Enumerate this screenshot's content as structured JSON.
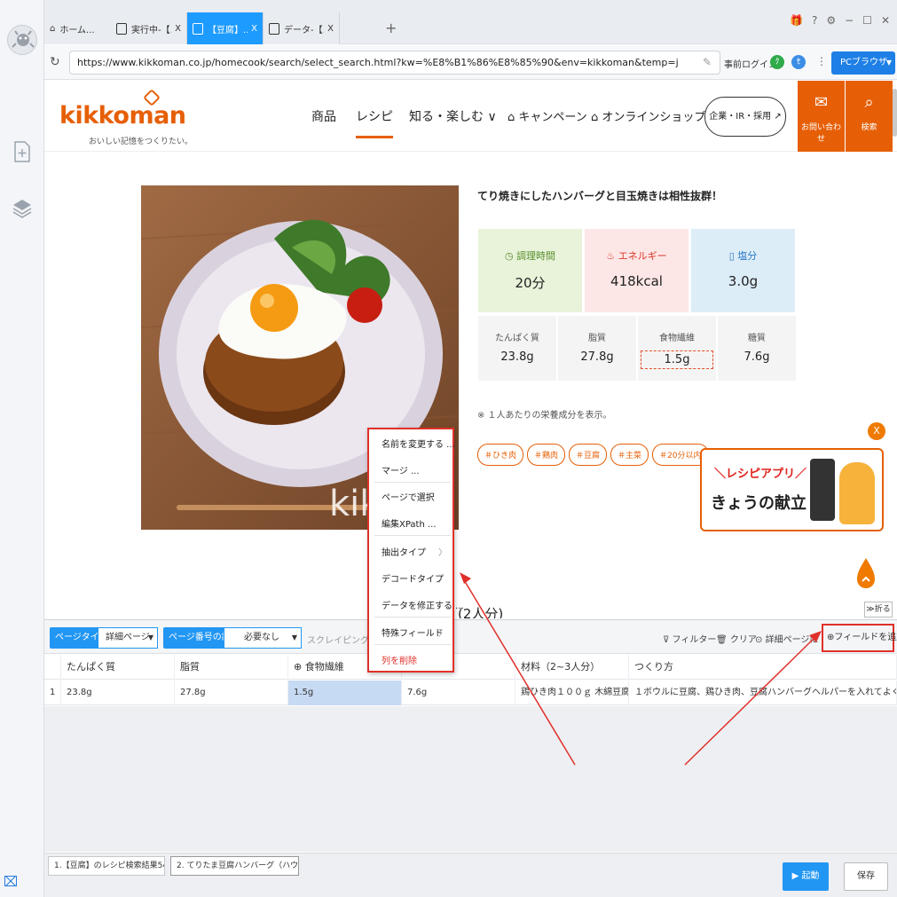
{
  "tabs": [
    {
      "label": "ホーム...",
      "close": ""
    },
    {
      "label": "実行中-【...",
      "close": "X"
    },
    {
      "label": "【豆腐】...",
      "close": "X"
    },
    {
      "label": "データ-【...",
      "close": "X"
    }
  ],
  "tab_plus": "+",
  "window_controls": [
    "🎁",
    "?",
    "⚙",
    "−",
    "☐",
    "✕"
  ],
  "address": {
    "url": "https://www.kikkoman.co.jp/homecook/search/select_search.html?kw=%E8%B1%86%E8%85%90&env=kikkoman&temp=j",
    "prelogin": "事前ログイン",
    "pc_browser": "PCブラウザ"
  },
  "site": {
    "logo": "kikkoman",
    "logo_sub": "おいしい記憶をつくりたい。",
    "nav": [
      "商品",
      "レシピ",
      "知る・楽しむ ∨",
      "⌂ キャンペーン",
      "⌂ オンラインショップ"
    ],
    "corp_button": "企業・IR・採用 ↗",
    "contact": "お問い合わせ",
    "search": "検索",
    "photo_watermark": "kikk"
  },
  "recipe": {
    "tagline": "てり焼きにしたハンバーグと目玉焼きは相性抜群！",
    "nutrition_top": [
      {
        "label": "調理時間",
        "value": "20分",
        "icon": "clock-icon",
        "bg": "#e8f3da",
        "color": "#5a8f2e"
      },
      {
        "label": "エネルギー",
        "value": "418kcal",
        "icon": "flame-icon",
        "bg": "#fde7e6",
        "color": "#d9362b"
      },
      {
        "label": "塩分",
        "value": "3.0g",
        "icon": "salt-icon",
        "bg": "#dcedf8",
        "color": "#2a78c4"
      }
    ],
    "nutrition_small": [
      {
        "label": "たんぱく質",
        "value": "23.8g"
      },
      {
        "label": "脂質",
        "value": "27.8g"
      },
      {
        "label": "食物繊維",
        "value": "1.5g"
      },
      {
        "label": "糖質",
        "value": "7.6g"
      }
    ],
    "note": "※ １人あたりの栄養成分を表示。",
    "tags": [
      "＃ひき肉",
      "＃鶏肉",
      "＃豆腐",
      "＃主菜",
      "＃20分以内"
    ],
    "banner_title": "＼レシピアプリ／",
    "banner_sub": "きょうの献立",
    "banner_close": "X",
    "fold": "≫折る",
    "partial_heading": "(2人分)"
  },
  "context_menu": {
    "items": [
      {
        "label": "名前を変更する ...",
        "arrow": ""
      },
      {
        "label": "マージ ...",
        "arrow": ""
      },
      {
        "label": "ページで選択",
        "arrow": ""
      },
      {
        "label": "編集XPath ...",
        "arrow": ""
      },
      {
        "label": "抽出タイプ",
        "arrow": "〉"
      },
      {
        "label": "デコードタイプ",
        "arrow": "〉"
      },
      {
        "label": "データを修正する ...",
        "arrow": ""
      },
      {
        "label": "特殊フィールド",
        "arrow": "〉"
      },
      {
        "label": "列を削除",
        "arrow": ""
      }
    ]
  },
  "panel": {
    "page_type_label": "ページタイプ",
    "page_type_value": "詳細ページ",
    "page_number_label": "ページ番号の設定",
    "page_number_value": "必要なし",
    "scraping_range": "スクレイピング範囲",
    "filter": "フィルター",
    "clear": "クリア",
    "detail_page": "詳細ページに行く",
    "add_field": "フィールドを追加",
    "columns": [
      "たんぱく質",
      "脂質",
      "食物繊維",
      "",
      "材料（2~3人分）",
      "つくり方"
    ],
    "row": {
      "index": "1",
      "cells": [
        "23.8g",
        "27.8g",
        "1.5g",
        "7.6g",
        "鶏ひき肉１００ｇ 木綿豆腐１５...",
        "１ボウルに豆腐、鶏ひき肉、豆腐ハンバーグヘルパーを入れてよく混ぜ合わせる。2..."
      ]
    },
    "bottom_tabs": [
      "1.【豆腐】のレシピ検索結果548...",
      "2. てりたま豆腐ハンバーグ（ハウ..."
    ],
    "start": "起動",
    "save": "保存"
  },
  "colors": {
    "kikkoman_orange": "#e65f06",
    "accent_blue": "#2196f3",
    "annotation_red": "#e0302a"
  }
}
